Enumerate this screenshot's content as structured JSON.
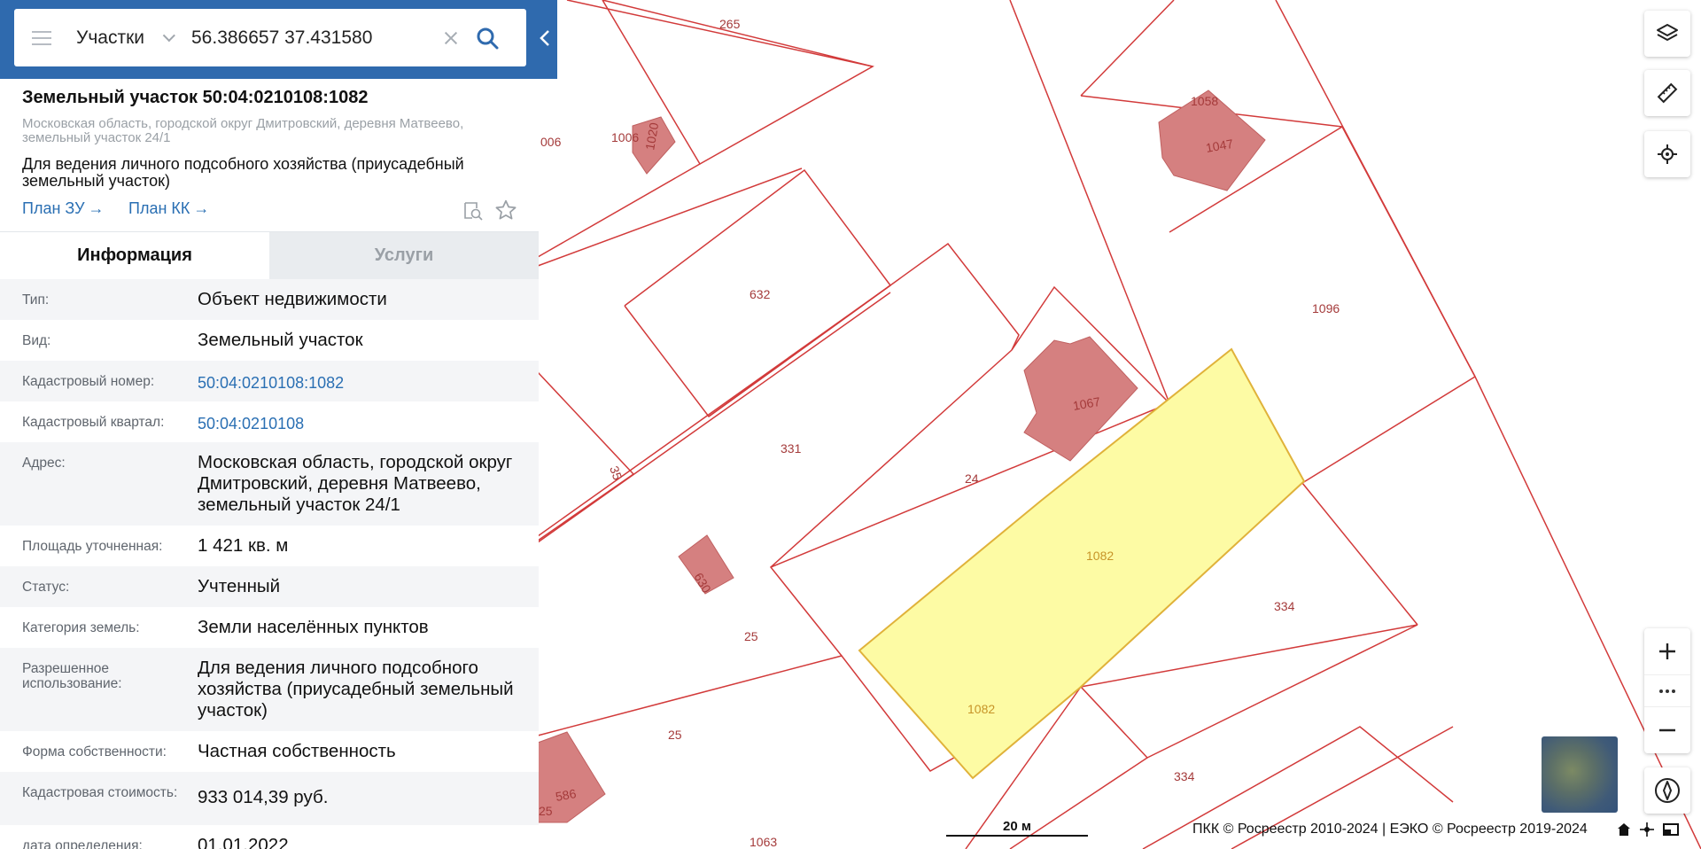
{
  "search": {
    "layer": "Участки",
    "query": "56.386657 37.431580"
  },
  "object": {
    "title": "Земельный участок 50:04:0210108:1082",
    "address": "Московская область, городской округ Дмитровский, деревня Матвеево, земельный участок 24/1",
    "purpose": "Для ведения личного подсобного хозяйства (приусадебный земельный участок)",
    "plan_zu": "План ЗУ",
    "plan_kk": "План КК"
  },
  "tabs": {
    "info": "Информация",
    "services": "Услуги"
  },
  "info_rows": [
    {
      "label": "Тип:",
      "value": "Объект недвижимости"
    },
    {
      "label": "Вид:",
      "value": "Земельный участок"
    },
    {
      "label": "Кадастровый номер:",
      "value": "50:04:0210108:1082"
    },
    {
      "label": "Кадастровый квартал:",
      "value": "50:04:0210108"
    },
    {
      "label": "Адрес:",
      "value": "Московская область, городской округ Дмитровский, деревня Матвеево, земельный участок 24/1"
    },
    {
      "label": "Площадь уточненная:",
      "value": "1 421 кв. м"
    },
    {
      "label": "Статус:",
      "value": "Учтенный"
    },
    {
      "label": "Категория земель:",
      "value": "Земли населённых пунктов"
    },
    {
      "label": "Разрешенное использование:",
      "value": "Для ведения личного подсобного хозяйства (приусадебный земельный участок)"
    },
    {
      "label": "Форма собственности:",
      "value": "Частная собственность"
    },
    {
      "label": "Кадастровая стоимость:",
      "value": "933 014,39 руб."
    },
    {
      "label": "дата определения:",
      "value": "01.01.2022"
    }
  ],
  "map": {
    "plot_labels": [
      "265",
      "006",
      "1006",
      "1020",
      "1058",
      "1047",
      "632",
      "1096",
      "1067",
      "331",
      "24",
      "35",
      "1082",
      "1082",
      "334",
      "630",
      "25",
      "25",
      "586",
      "1082",
      "334",
      "1063",
      "25"
    ],
    "scale": "20 м",
    "copyright": "ПКК © Росреестр 2010-2024 | ЕЭКО © Росреестр 2019-2024",
    "colors": {
      "boundary": "#d23a3a",
      "building": "#d58080",
      "selected_fill": "#fdfba4",
      "selected_stroke": "#e0b23a",
      "header": "#2f6aae"
    }
  }
}
